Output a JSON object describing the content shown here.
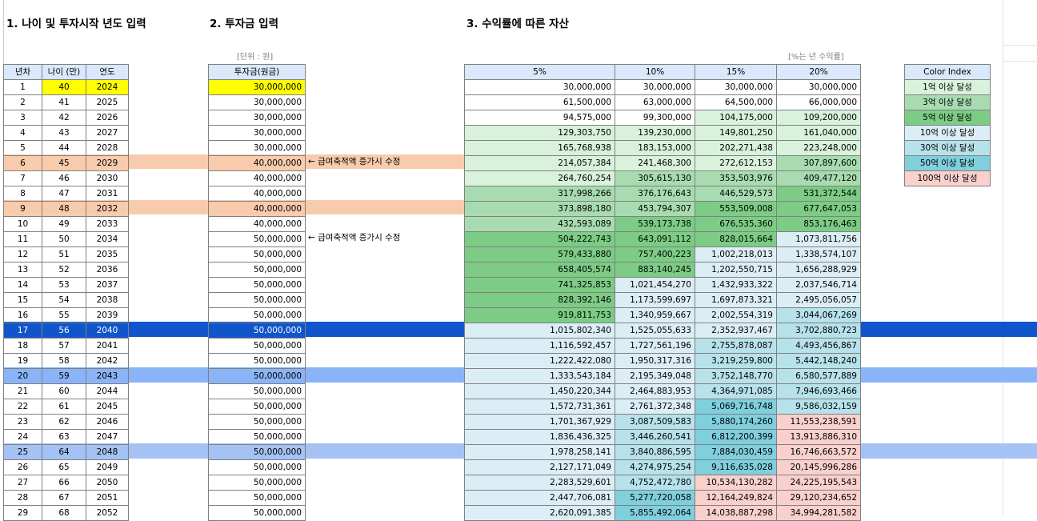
{
  "headings": {
    "section1": "1. 나이 및 투자시작 년도 입력",
    "section2": "2. 투자금 입력",
    "section3": "3. 수익률에 따른 자산"
  },
  "notes": {
    "unit": "[단위 : 원]",
    "rate": "[%는 년 수익률]"
  },
  "left_table": {
    "headers": [
      "년차",
      "나이 (만)",
      "연도"
    ],
    "rows": [
      [
        "1",
        "40",
        "2024"
      ],
      [
        "2",
        "41",
        "2025"
      ],
      [
        "3",
        "42",
        "2026"
      ],
      [
        "4",
        "43",
        "2027"
      ],
      [
        "5",
        "44",
        "2028"
      ],
      [
        "6",
        "45",
        "2029"
      ],
      [
        "7",
        "46",
        "2030"
      ],
      [
        "8",
        "47",
        "2031"
      ],
      [
        "9",
        "48",
        "2032"
      ],
      [
        "10",
        "49",
        "2033"
      ],
      [
        "11",
        "50",
        "2034"
      ],
      [
        "12",
        "51",
        "2035"
      ],
      [
        "13",
        "52",
        "2036"
      ],
      [
        "14",
        "53",
        "2037"
      ],
      [
        "15",
        "54",
        "2038"
      ],
      [
        "16",
        "55",
        "2039"
      ],
      [
        "17",
        "56",
        "2040"
      ],
      [
        "18",
        "57",
        "2041"
      ],
      [
        "19",
        "58",
        "2042"
      ],
      [
        "20",
        "59",
        "2043"
      ],
      [
        "21",
        "60",
        "2044"
      ],
      [
        "22",
        "61",
        "2045"
      ],
      [
        "23",
        "62",
        "2046"
      ],
      [
        "24",
        "63",
        "2047"
      ],
      [
        "25",
        "64",
        "2048"
      ],
      [
        "26",
        "65",
        "2049"
      ],
      [
        "27",
        "66",
        "2050"
      ],
      [
        "28",
        "67",
        "2051"
      ],
      [
        "29",
        "68",
        "2052"
      ]
    ]
  },
  "invest_table": {
    "header": "투자금(원금)",
    "values": [
      "30,000,000",
      "30,000,000",
      "30,000,000",
      "30,000,000",
      "30,000,000",
      "40,000,000",
      "40,000,000",
      "40,000,000",
      "40,000,000",
      "40,000,000",
      "50,000,000",
      "50,000,000",
      "50,000,000",
      "50,000,000",
      "50,000,000",
      "50,000,000",
      "50,000,000",
      "50,000,000",
      "50,000,000",
      "50,000,000",
      "50,000,000",
      "50,000,000",
      "50,000,000",
      "50,000,000",
      "50,000,000",
      "50,000,000",
      "50,000,000",
      "50,000,000",
      "50,000,000"
    ],
    "memo_row6": "← 급여축적액 증가시 수정",
    "memo_row11": "← 급여축적액 증가시 수정"
  },
  "returns_table": {
    "headers": [
      "5%",
      "10%",
      "15%",
      "20%"
    ],
    "rows": [
      [
        "30,000,000",
        "30,000,000",
        "30,000,000",
        "30,000,000"
      ],
      [
        "61,500,000",
        "63,000,000",
        "64,500,000",
        "66,000,000"
      ],
      [
        "94,575,000",
        "99,300,000",
        "104,175,000",
        "109,200,000"
      ],
      [
        "129,303,750",
        "139,230,000",
        "149,801,250",
        "161,040,000"
      ],
      [
        "165,768,938",
        "183,153,000",
        "202,271,438",
        "223,248,000"
      ],
      [
        "214,057,384",
        "241,468,300",
        "272,612,153",
        "307,897,600"
      ],
      [
        "264,760,254",
        "305,615,130",
        "353,503,976",
        "409,477,120"
      ],
      [
        "317,998,266",
        "376,176,643",
        "446,529,573",
        "531,372,544"
      ],
      [
        "373,898,180",
        "453,794,307",
        "553,509,008",
        "677,647,053"
      ],
      [
        "432,593,089",
        "539,173,738",
        "676,535,360",
        "853,176,463"
      ],
      [
        "504,222,743",
        "643,091,112",
        "828,015,664",
        "1,073,811,756"
      ],
      [
        "579,433,880",
        "757,400,223",
        "1,002,218,013",
        "1,338,574,107"
      ],
      [
        "658,405,574",
        "883,140,245",
        "1,202,550,715",
        "1,656,288,929"
      ],
      [
        "741,325,853",
        "1,021,454,270",
        "1,432,933,322",
        "2,037,546,714"
      ],
      [
        "828,392,146",
        "1,173,599,697",
        "1,697,873,321",
        "2,495,056,057"
      ],
      [
        "919,811,753",
        "1,340,959,667",
        "2,002,554,319",
        "3,044,067,269"
      ],
      [
        "1,015,802,340",
        "1,525,055,633",
        "2,352,937,467",
        "3,702,880,723"
      ],
      [
        "1,116,592,457",
        "1,727,561,196",
        "2,755,878,087",
        "4,493,456,867"
      ],
      [
        "1,222,422,080",
        "1,950,317,316",
        "3,219,259,800",
        "5,442,148,240"
      ],
      [
        "1,333,543,184",
        "2,195,349,048",
        "3,752,148,770",
        "6,580,577,889"
      ],
      [
        "1,450,220,344",
        "2,464,883,953",
        "4,364,971,085",
        "7,946,693,466"
      ],
      [
        "1,572,731,361",
        "2,761,372,348",
        "5,069,716,748",
        "9,586,032,159"
      ],
      [
        "1,701,367,929",
        "3,087,509,583",
        "5,880,174,260",
        "11,553,238,591"
      ],
      [
        "1,836,436,325",
        "3,446,260,541",
        "6,812,200,399",
        "13,913,886,310"
      ],
      [
        "1,978,258,141",
        "3,840,886,595",
        "7,884,030,459",
        "16,746,663,572"
      ],
      [
        "2,127,171,049",
        "4,274,975,254",
        "9,116,635,028",
        "20,145,996,286"
      ],
      [
        "2,283,529,601",
        "4,752,472,780",
        "10,534,130,282",
        "24,225,195,543"
      ],
      [
        "2,447,706,081",
        "5,277,720,058",
        "12,164,249,824",
        "29,120,234,652"
      ],
      [
        "2,620,091,385",
        "5,855,492,064",
        "14,038,887,298",
        "34,994,281,582"
      ]
    ],
    "tiers": [
      [
        0,
        0,
        0,
        0
      ],
      [
        0,
        0,
        0,
        0
      ],
      [
        0,
        0,
        1,
        1
      ],
      [
        1,
        1,
        1,
        1
      ],
      [
        1,
        1,
        1,
        1
      ],
      [
        1,
        1,
        1,
        2
      ],
      [
        1,
        2,
        2,
        2
      ],
      [
        2,
        2,
        2,
        3
      ],
      [
        2,
        2,
        3,
        3
      ],
      [
        2,
        3,
        3,
        3
      ],
      [
        3,
        3,
        3,
        4
      ],
      [
        3,
        3,
        4,
        4
      ],
      [
        3,
        3,
        4,
        4
      ],
      [
        3,
        4,
        4,
        4
      ],
      [
        3,
        4,
        4,
        4
      ],
      [
        3,
        4,
        4,
        5
      ],
      [
        4,
        4,
        4,
        5
      ],
      [
        4,
        4,
        5,
        5
      ],
      [
        4,
        4,
        5,
        5
      ],
      [
        4,
        4,
        5,
        5
      ],
      [
        4,
        4,
        5,
        5
      ],
      [
        4,
        4,
        6,
        5
      ],
      [
        4,
        5,
        6,
        7
      ],
      [
        4,
        5,
        6,
        7
      ],
      [
        4,
        5,
        6,
        7
      ],
      [
        4,
        5,
        6,
        7
      ],
      [
        4,
        5,
        7,
        7
      ],
      [
        4,
        6,
        7,
        7
      ],
      [
        4,
        6,
        7,
        7
      ]
    ]
  },
  "color_index": {
    "header": "Color Index",
    "items": [
      {
        "label": "1억 이상 달성",
        "tier": 1
      },
      {
        "label": "3억 이상 달성",
        "tier": 2
      },
      {
        "label": "5억 이상 달성",
        "tier": 3
      },
      {
        "label": "10억 이상 달성",
        "tier": 4
      },
      {
        "label": "30억 이상 달성",
        "tier": 5
      },
      {
        "label": "50억 이상 달성",
        "tier": 6
      },
      {
        "label": "100억 이상 달성",
        "tier": 7
      }
    ]
  }
}
